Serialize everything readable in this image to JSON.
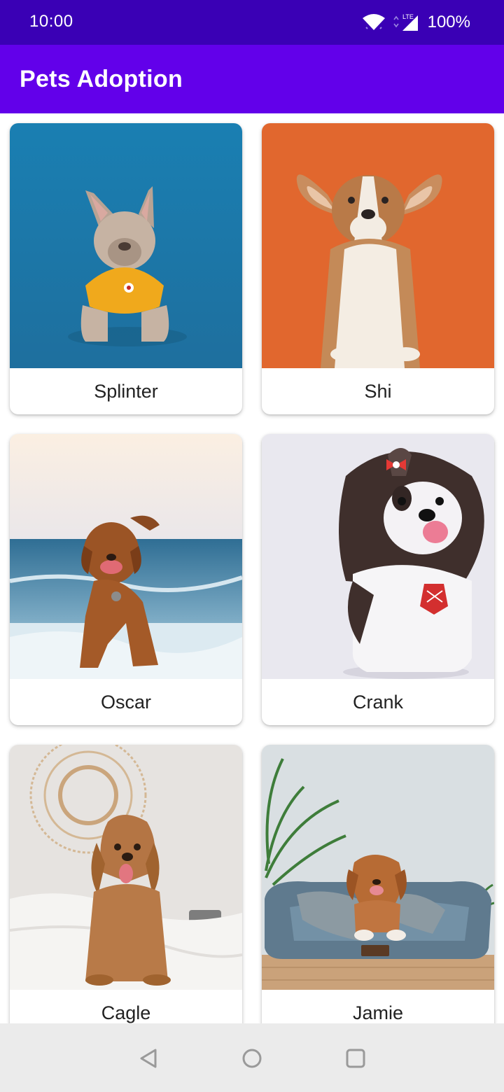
{
  "status_bar": {
    "time": "10:00",
    "battery": "100%",
    "network_label": "LTE",
    "icons": [
      "wifi-icon",
      "lte-signal-icon"
    ],
    "background": "#3a00b5"
  },
  "app_bar": {
    "title": "Pets Adoption",
    "background": "#6200ea"
  },
  "pets": [
    {
      "name": "Splinter",
      "image": "french-bulldog-yellow-shirt-blue-background"
    },
    {
      "name": "Shi",
      "image": "corgi-puppy-orange-background"
    },
    {
      "name": "Oscar",
      "image": "retriever-running-on-beach"
    },
    {
      "name": "Crank",
      "image": "shih-tzu-white-background"
    },
    {
      "name": "Cagle",
      "image": "labradoodle-sitting-on-bed"
    },
    {
      "name": "Jamie",
      "image": "retriever-in-grey-dog-bed"
    }
  ],
  "nav_bar": {
    "buttons": [
      "back-icon",
      "home-icon",
      "recents-icon"
    ]
  }
}
